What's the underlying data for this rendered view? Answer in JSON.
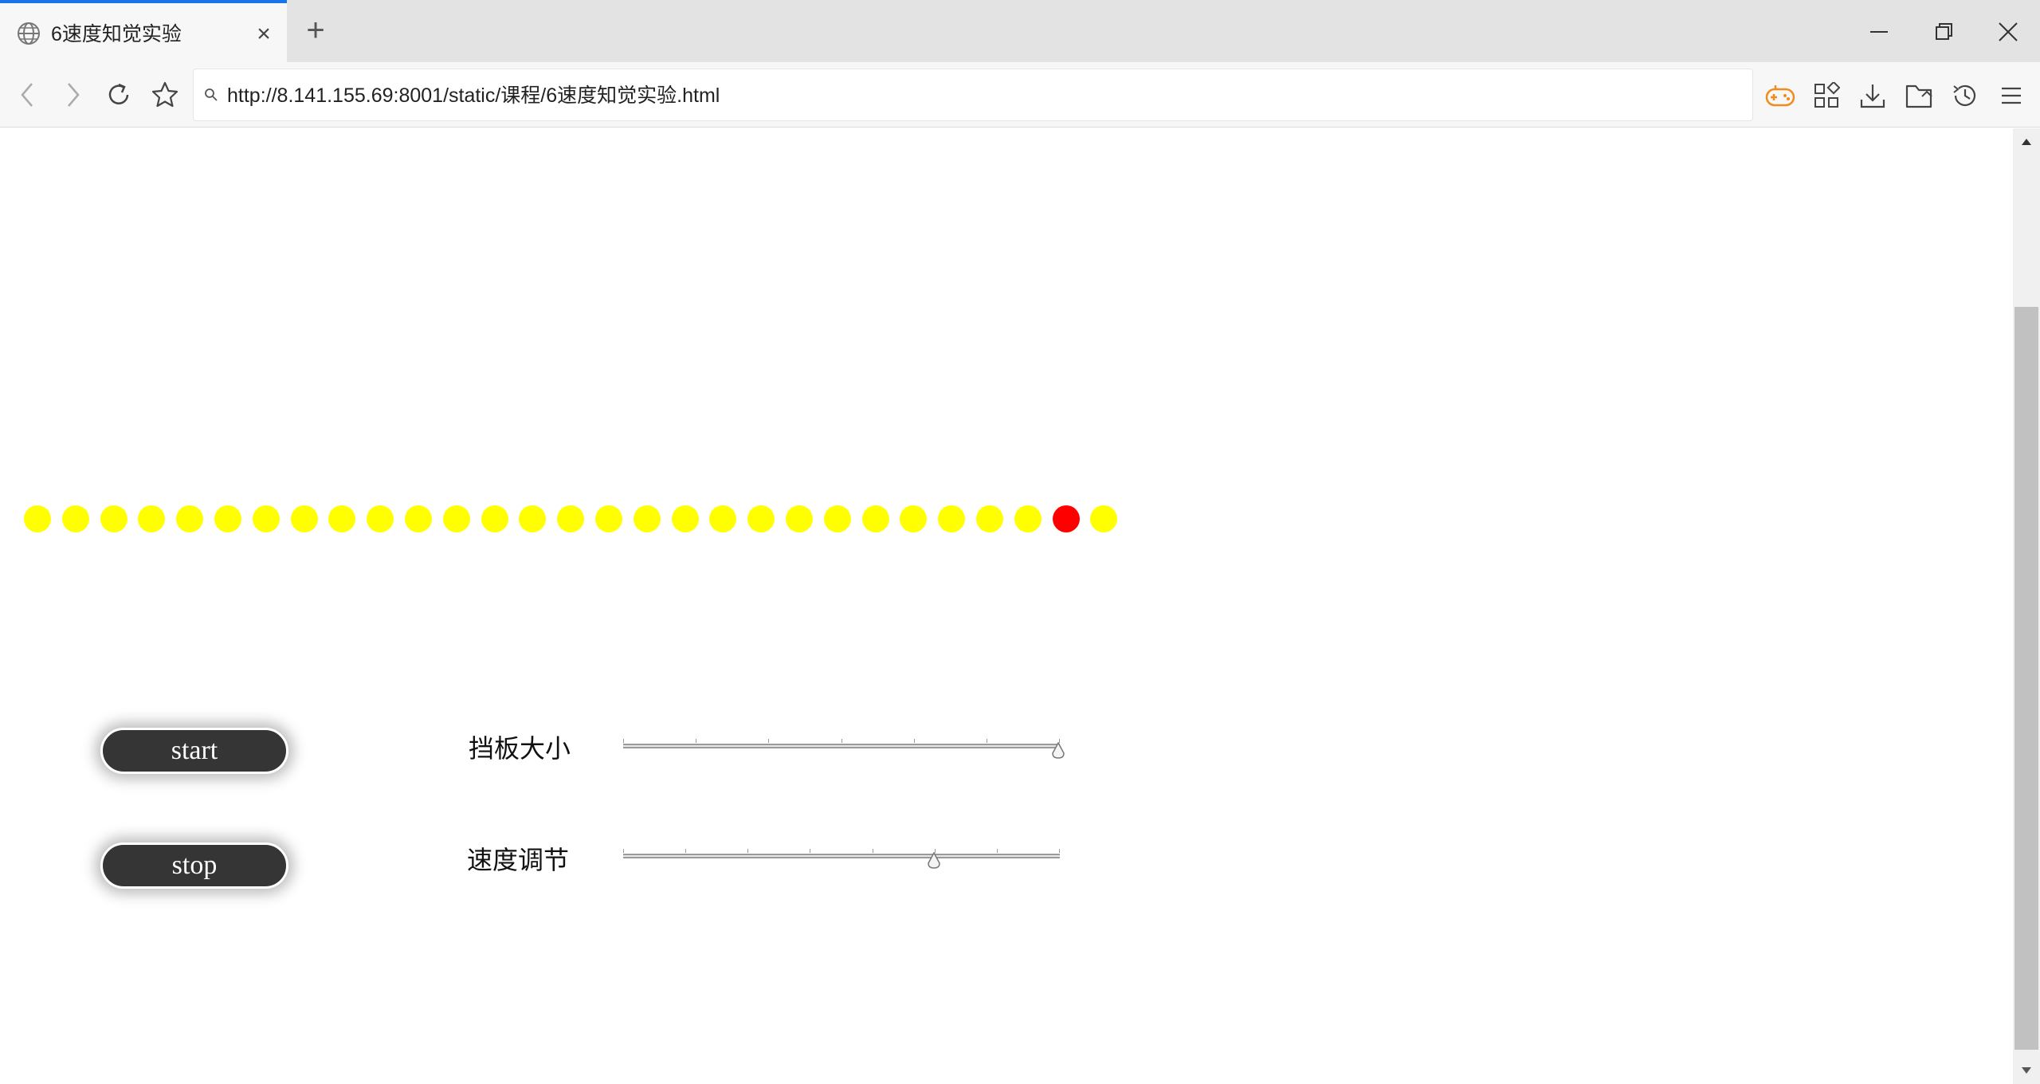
{
  "browser": {
    "tab_title": "6速度知觉实验",
    "url": "http://8.141.155.69:8001/static/课程/6速度知觉实验.html",
    "accent_color": "#1a73e8",
    "extension_color": "#f08c1e"
  },
  "experiment": {
    "ball_count": 29,
    "active_ball_index": 27,
    "ball_color": "#ffff00",
    "active_ball_color": "#ff0000",
    "start_label": "start",
    "stop_label": "stop",
    "baffle_label": "挡板大小",
    "speed_label": "速度调节",
    "baffle_value_fraction": 1.0,
    "speed_value_fraction": 0.715
  }
}
